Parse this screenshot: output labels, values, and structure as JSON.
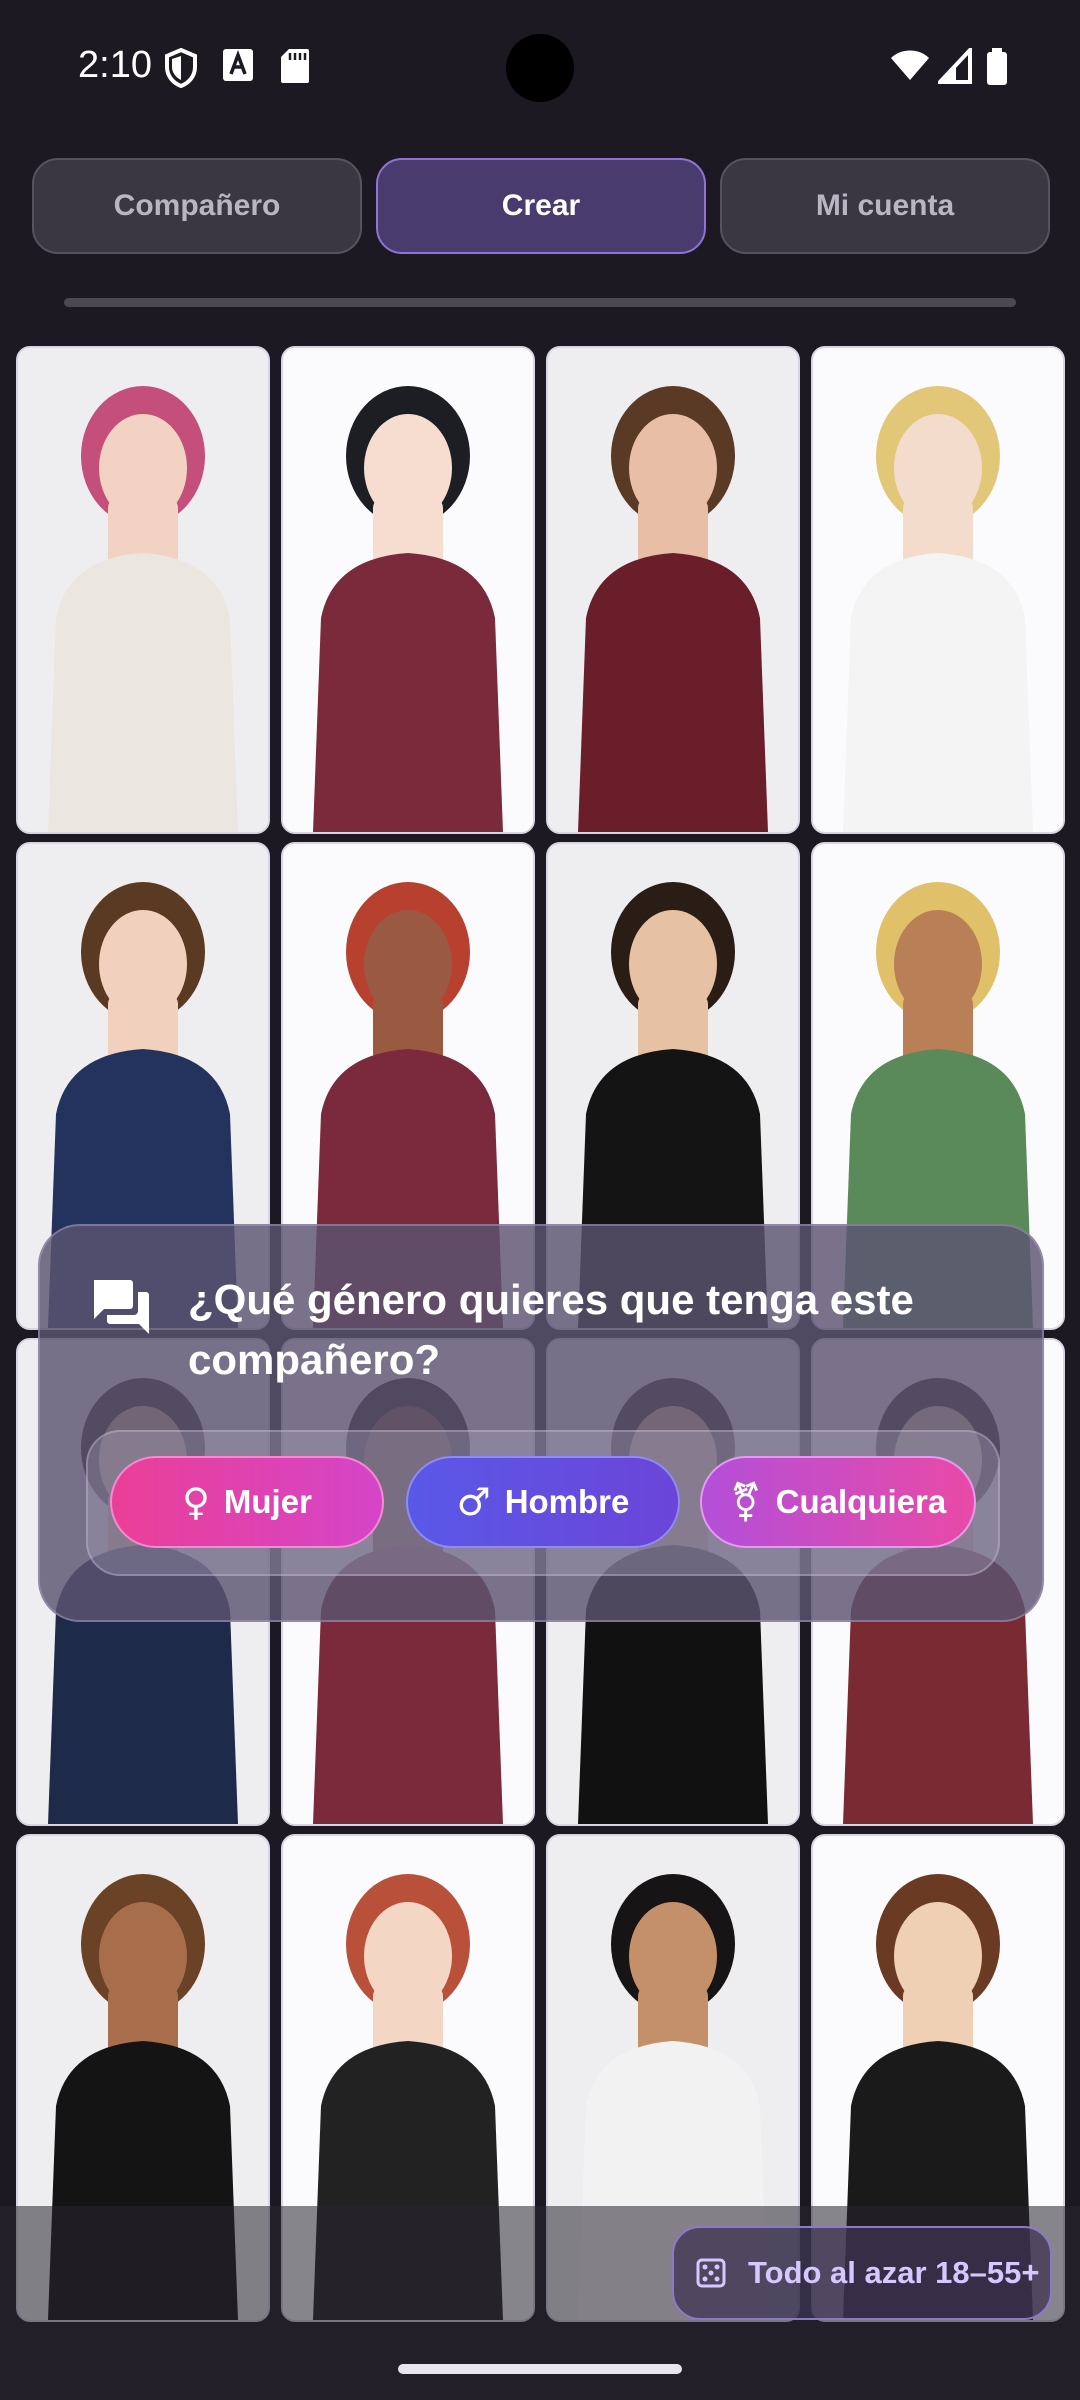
{
  "status_bar": {
    "time": "2:10",
    "left_icons": [
      "vpn-shield-icon",
      "font-a-icon",
      "sd-card-icon"
    ],
    "right_icons": [
      "wifi-icon",
      "signal-icon",
      "battery-icon"
    ]
  },
  "tabs": [
    {
      "label": "Compañero",
      "active": false
    },
    {
      "label": "Crear",
      "active": true
    },
    {
      "label": "Mi cuenta",
      "active": false
    }
  ],
  "progress": {
    "value": 0
  },
  "gallery": {
    "cards": [
      {
        "style": "photo",
        "subject": "woman, pink hair, cream blouse"
      },
      {
        "style": "anime",
        "subject": "woman, black bob hair, maroon crop top, denim shorts"
      },
      {
        "style": "photo",
        "subject": "man, wavy brown hair, maroon shirt"
      },
      {
        "style": "anime",
        "subject": "man, blond hair, white blazer"
      },
      {
        "style": "photo",
        "subject": "woman, brown hair, navy slip dress"
      },
      {
        "style": "anime",
        "subject": "woman, long red hair, maroon crop top"
      },
      {
        "style": "photo",
        "subject": "man, short dark hair, black t-shirt"
      },
      {
        "style": "anime",
        "subject": "man, long blond hair, green tank top"
      },
      {
        "style": "photo",
        "subject": "woman, navy satin dress"
      },
      {
        "style": "anime",
        "subject": "woman, dark hair, maroon top, ripped jeans"
      },
      {
        "style": "photo",
        "subject": "man, black t-shirt"
      },
      {
        "style": "anime",
        "subject": "man, maroon shirt"
      },
      {
        "style": "photo",
        "subject": "woman, curly hair, black halter top"
      },
      {
        "style": "anime",
        "subject": "woman, red updo hair, black dress"
      },
      {
        "style": "photo",
        "subject": "man, long black hair, white shirt"
      },
      {
        "style": "anime",
        "subject": "man, long brown hair, black t-shirt"
      }
    ]
  },
  "dialog": {
    "icon": "chat-bubbles-icon",
    "question": "¿Qué género quieres que tenga este compañero?",
    "options": [
      {
        "symbol": "♀",
        "label": "Mujer",
        "color": "#e2409f"
      },
      {
        "symbol": "♂",
        "label": "Hombre",
        "color": "#6150e0"
      },
      {
        "symbol": "⚧",
        "label": "Cualquiera",
        "color": "#c64dc8"
      }
    ]
  },
  "random_button": {
    "icon": "dice-icon",
    "label": "Todo al azar 18–55+"
  },
  "colors": {
    "background": "#1c1923",
    "accent": "#8f74d6",
    "tab_active_bg": "#4a3b6e"
  }
}
